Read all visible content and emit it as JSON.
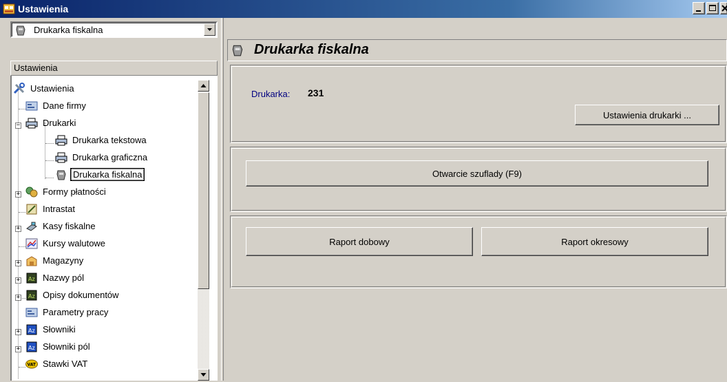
{
  "window": {
    "title": "Ustawienia"
  },
  "left": {
    "combo_value": "Drukarka fiskalna",
    "tree_header": "Ustawienia",
    "tree": [
      {
        "label": "Ustawienia",
        "icon": "tools-icon"
      },
      {
        "label": "Dane firmy",
        "icon": "company-icon"
      },
      {
        "label": "Drukarki",
        "icon": "printer-icon"
      },
      {
        "label": "Drukarka tekstowa",
        "icon": "printer-icon"
      },
      {
        "label": "Drukarka graficzna",
        "icon": "printer-icon"
      },
      {
        "label": "Drukarka fiskalna",
        "icon": "fiscal-printer-icon"
      },
      {
        "label": "Formy płatności",
        "icon": "payment-icon"
      },
      {
        "label": "Intrastat",
        "icon": "intrastat-icon"
      },
      {
        "label": "Kasy fiskalne",
        "icon": "cash-register-icon"
      },
      {
        "label": "Kursy walutowe",
        "icon": "chart-icon"
      },
      {
        "label": "Magazyny",
        "icon": "warehouse-icon"
      },
      {
        "label": "Nazwy pól",
        "icon": "az-icon"
      },
      {
        "label": "Opisy dokumentów",
        "icon": "az-icon"
      },
      {
        "label": "Parametry pracy",
        "icon": "company-icon"
      },
      {
        "label": "Słowniki",
        "icon": "az-icon"
      },
      {
        "label": "Słowniki pól",
        "icon": "az-icon"
      },
      {
        "label": "Stawki VAT",
        "icon": "vat-icon",
        "badge": "VAT"
      }
    ]
  },
  "main": {
    "title": "Drukarka fiskalna",
    "printer_label": "Drukarka:",
    "printer_value": "231",
    "printer_settings_button": "Ustawienia drukarki ...",
    "drawer_button": "Otwarcie szuflady (F9)",
    "daily_report_button": "Raport dobowy",
    "period_report_button": "Raport okresowy"
  }
}
